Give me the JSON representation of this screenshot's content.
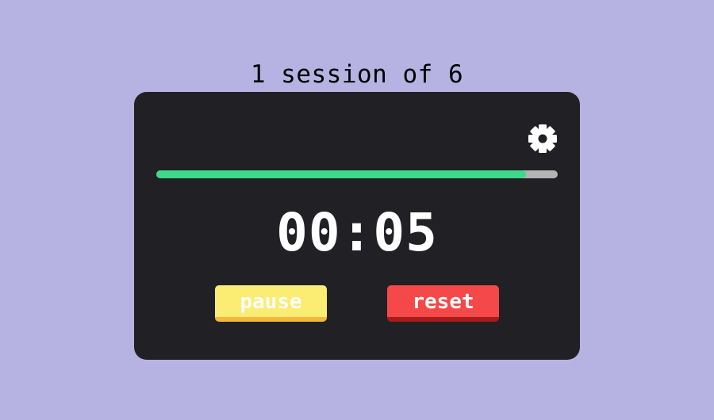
{
  "session": {
    "label": "1 session of 6"
  },
  "timer": {
    "time": "00:05",
    "progress_percent": 92
  },
  "controls": {
    "pause_label": "pause",
    "reset_label": "reset"
  },
  "icons": {
    "settings": "gear-icon"
  },
  "colors": {
    "background": "#b6b3e2",
    "card": "#212025",
    "progress_fill": "#3ed98a",
    "progress_track": "#b4b4b4",
    "pause_button": "#fbed74",
    "reset_button": "#f54848",
    "text": "#ffffff"
  }
}
